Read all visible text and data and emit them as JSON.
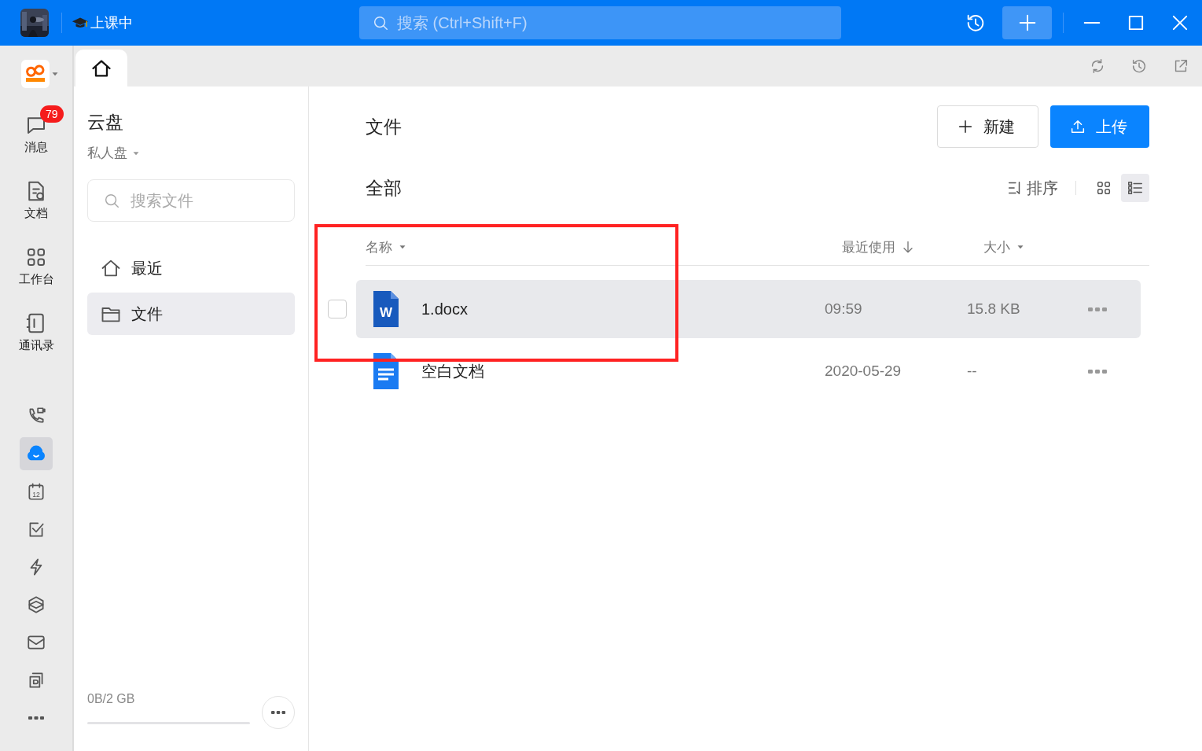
{
  "window": {
    "status": "上课中",
    "search_placeholder": "搜索 (Ctrl+Shift+F)"
  },
  "rail": {
    "items": [
      {
        "label": "消息",
        "badge": "79"
      },
      {
        "label": "文档"
      },
      {
        "label": "工作台"
      },
      {
        "label": "通讯录"
      }
    ],
    "tools": [
      {
        "selected": false
      },
      {
        "selected": true
      },
      {
        "selected": false,
        "text": "12"
      },
      {
        "selected": false
      },
      {
        "selected": false
      },
      {
        "selected": false
      },
      {
        "selected": false
      },
      {
        "selected": false
      },
      {
        "selected": false
      }
    ]
  },
  "tabs": [
    {
      "selected": true
    }
  ],
  "sidebar": {
    "title": "云盘",
    "drive": "私人盘",
    "search_placeholder": "搜索文件",
    "items": [
      {
        "label": "最近",
        "selected": false
      },
      {
        "label": "文件",
        "selected": true
      }
    ],
    "storage": {
      "text": "0B/2 GB",
      "level": 0
    }
  },
  "main": {
    "title": "文件",
    "buttons": [
      {
        "kind": "outline",
        "label": "新建"
      },
      {
        "kind": "primary",
        "label": "上传"
      }
    ],
    "section": "全部",
    "sort_label": "排序",
    "views": [
      {
        "selected": false
      },
      {
        "selected": true
      }
    ],
    "table": {
      "columns": [
        {
          "label": "名称"
        },
        {
          "label": "最近使用"
        },
        {
          "label": "大小"
        }
      ],
      "rows": [
        {
          "kind": "word",
          "letter": "W",
          "name": "1.docx",
          "used": "09:59",
          "size": "15.8 KB",
          "hovered": true,
          "checked": false
        },
        {
          "kind": "doc",
          "name": "空白文档",
          "used": "2020-05-29",
          "size": "--",
          "hovered": false,
          "checked": false
        }
      ]
    }
  },
  "annotation": {
    "kind": "red-frame"
  }
}
